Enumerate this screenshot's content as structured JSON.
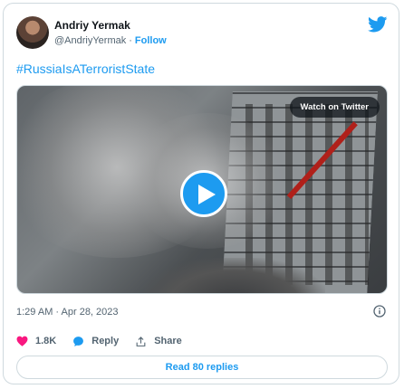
{
  "author": {
    "name": "Andriy Yermak",
    "handle": "@AndriyYermak",
    "separator": "·",
    "follow_label": "Follow"
  },
  "tweet": {
    "text": "#RussiaIsATerroristState",
    "timestamp": "1:29 AM · Apr 28, 2023"
  },
  "media": {
    "watch_label": "Watch on Twitter"
  },
  "actions": {
    "likes": "1.8K",
    "reply_label": "Reply",
    "share_label": "Share"
  },
  "read_replies_label": "Read 80 replies",
  "colors": {
    "accent": "#1d9bf0",
    "like": "#f91880",
    "muted": "#536471",
    "border": "#cfd9de"
  },
  "icons": [
    "twitter-bird-icon",
    "play-icon",
    "info-icon",
    "heart-icon",
    "reply-bubble-icon",
    "share-icon"
  ]
}
